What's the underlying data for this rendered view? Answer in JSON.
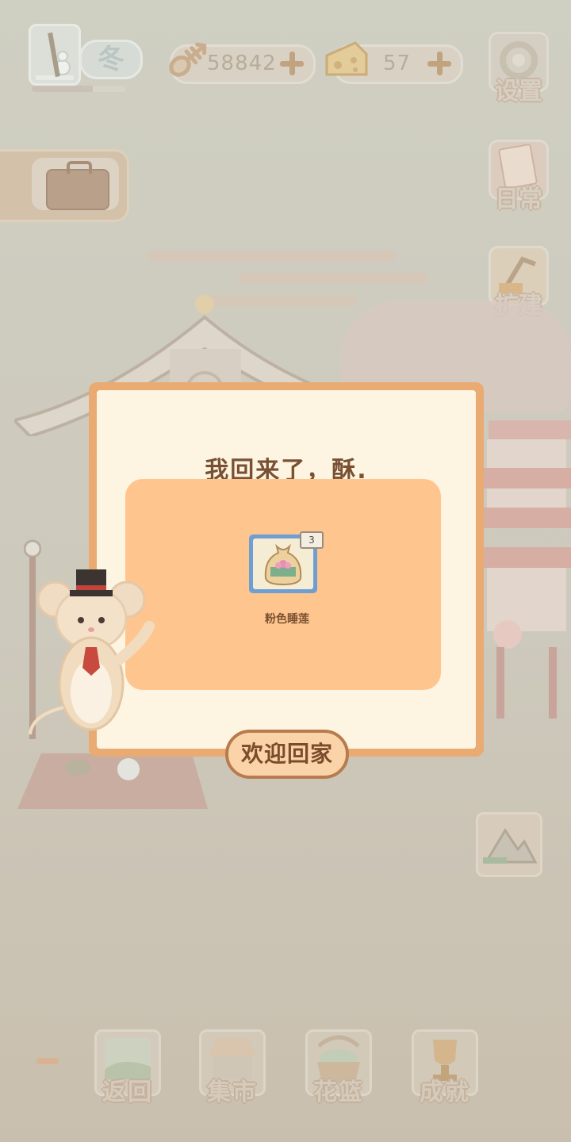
{
  "top_bar": {
    "season": {
      "label": "冬",
      "icon": "winter-tree-snowman-icon",
      "progress": 0.65
    },
    "fish_currency": {
      "value": "58842",
      "icon": "fish-bone-icon"
    },
    "cheese_currency": {
      "value": "57",
      "icon": "cheese-icon"
    }
  },
  "side_menu": {
    "settings": {
      "label": "设置",
      "icon": "gear-icon"
    },
    "daily": {
      "label": "日常",
      "icon": "tips-paper-icon"
    },
    "expand": {
      "label": "扩建",
      "icon": "construction-icon"
    }
  },
  "left_tab": {
    "icon": "briefcase-icon"
  },
  "dialog": {
    "title": "我回来了，酥.",
    "reward": {
      "name": "粉色睡莲",
      "count": "3",
      "icon": "seed-bag-lotus-icon"
    },
    "confirm_label": "欢迎回家"
  },
  "map_button": {
    "icon": "mountain-map-icon"
  },
  "bottom_nav": {
    "back": {
      "label": "返回",
      "icon": "window-landscape-icon"
    },
    "market": {
      "label": "集市",
      "icon": "market-stall-icon"
    },
    "basket": {
      "label": "花篮",
      "icon": "flower-basket-icon"
    },
    "achievements": {
      "label": "成就",
      "icon": "trophy-icon"
    }
  },
  "colors": {
    "dialog_border": "#e9ab72",
    "dialog_paper": "#fdf5e2",
    "panel": "#ffc58e",
    "text_brown": "#7a5033",
    "item_frame": "#6f9ed3"
  }
}
